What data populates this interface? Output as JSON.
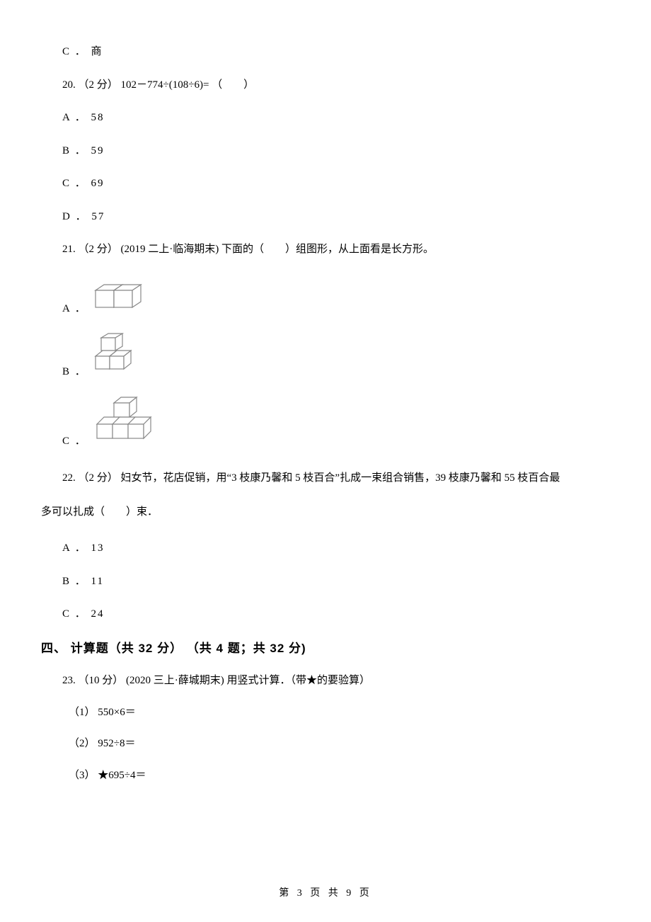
{
  "q19": {
    "opt_c": "C ． 商"
  },
  "q20": {
    "stem": "20. （2 分） 102－774÷(108÷6)= （　　）",
    "a": "A ． 58",
    "b": "B ． 59",
    "c": "C ． 69",
    "d": "D ． 57"
  },
  "q21": {
    "stem": "21. （2 分） (2019 二上·临海期末) 下面的（　　）组图形，从上面看是长方形。",
    "a_label": "A ．",
    "b_label": "B ．",
    "c_label": "C ．"
  },
  "q22": {
    "stem_line1": "22. （2 分） 妇女节，花店促销，用“3 枝康乃馨和 5 枝百合”扎成一束组合销售，39 枝康乃馨和 55 枝百合最",
    "stem_line2": "多可以扎成（　　）束．",
    "a": "A ． 13",
    "b": "B ． 11",
    "c": "C ． 24"
  },
  "section4": {
    "heading": "四、 计算题（共 32 分） （共 4 题；共 32 分)"
  },
  "q23": {
    "stem": "23. （10 分） (2020 三上·薛城期末) 用竖式计算．（带★的要验算）",
    "s1": "（1） 550×6＝",
    "s2": "（2） 952÷8＝",
    "s3": "（3） ★695÷4＝"
  },
  "footer": "第 3 页 共 9 页"
}
